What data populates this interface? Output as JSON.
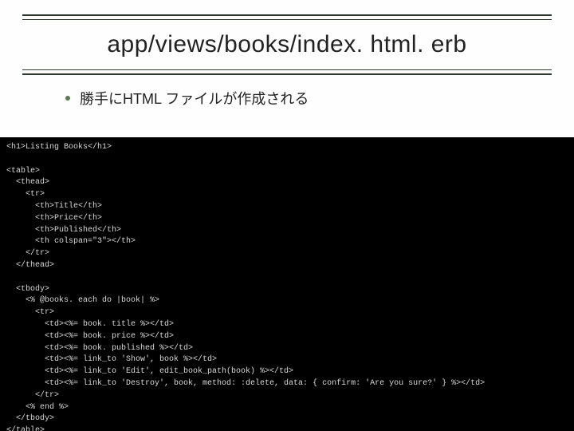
{
  "title": "app/views/books/index. html. erb",
  "bullet": "勝手にHTML ファイルが作成される",
  "code": "<h1>Listing Books</h1>\n\n<table>\n  <thead>\n    <tr>\n      <th>Title</th>\n      <th>Price</th>\n      <th>Published</th>\n      <th colspan=\"3\"></th>\n    </tr>\n  </thead>\n\n  <tbody>\n    <% @books. each do |book| %>\n      <tr>\n        <td><%= book. title %></td>\n        <td><%= book. price %></td>\n        <td><%= book. published %></td>\n        <td><%= link_to 'Show', book %></td>\n        <td><%= link_to 'Edit', edit_book_path(book) %></td>\n        <td><%= link_to 'Destroy', book, method: :delete, data: { confirm: 'Are you sure?' } %></td>\n      </tr>\n    <% end %>\n  </tbody>\n</table>\n\n<br>"
}
